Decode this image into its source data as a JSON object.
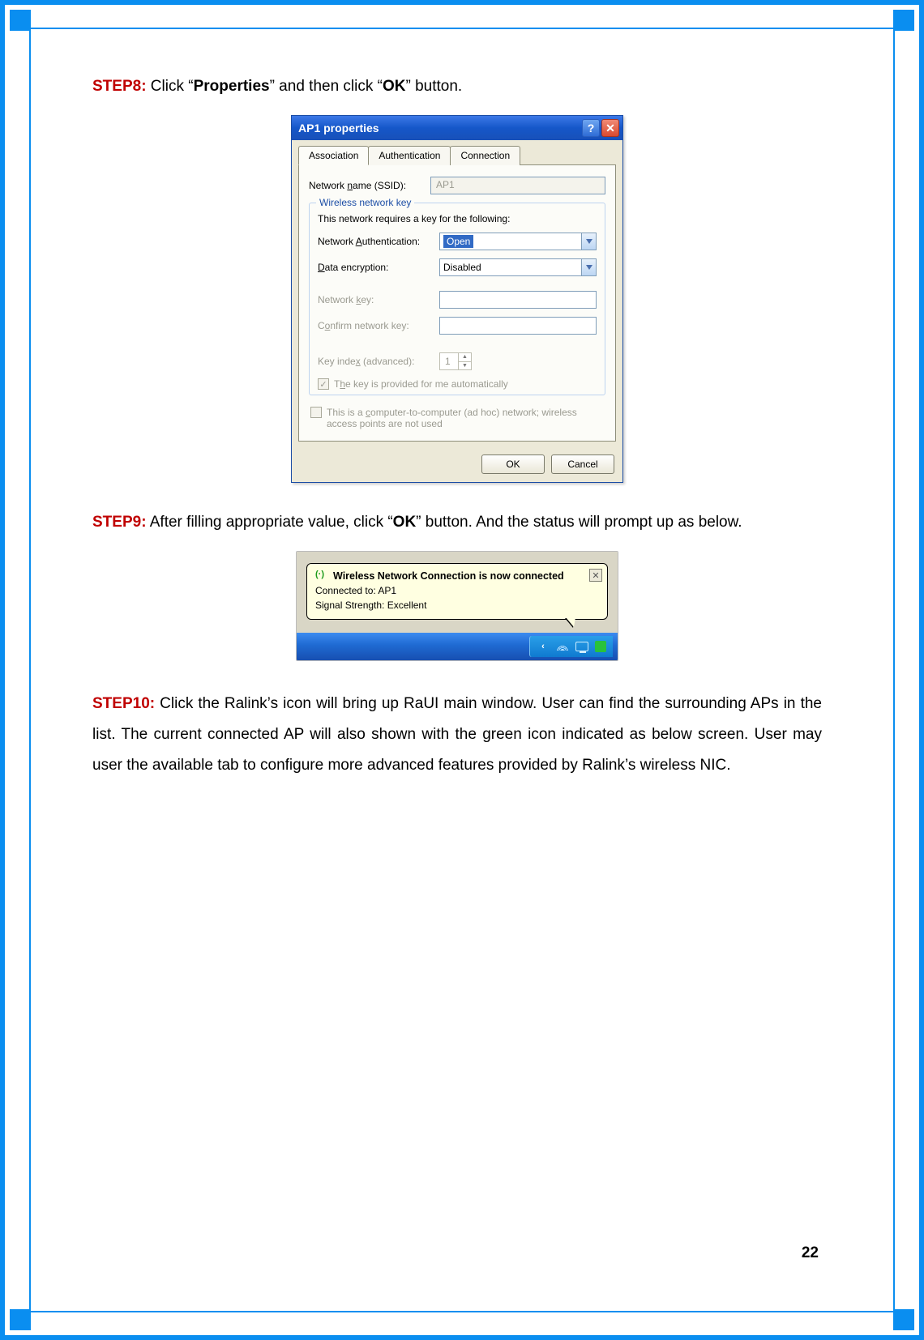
{
  "page_number": "22",
  "step8": {
    "label": "STEP8:",
    "text_before_properties": " Click “",
    "properties": "Properties",
    "text_mid": "” and then click “",
    "ok": "OK",
    "text_after_ok": "” button."
  },
  "dialog": {
    "title": "AP1 properties",
    "tabs": {
      "association": "Association",
      "authentication": "Authentication",
      "connection": "Connection"
    },
    "ssid_label_pre": "Network ",
    "ssid_label_u": "n",
    "ssid_label_post": "ame (SSID):",
    "ssid_value": "AP1",
    "group_legend": "Wireless network key",
    "group_desc": "This network requires a key for the following:",
    "auth_label_pre": "Network ",
    "auth_label_u": "A",
    "auth_label_post": "uthentication:",
    "auth_value": "Open",
    "enc_label_u": "D",
    "enc_label_post": "ata encryption:",
    "enc_value": "Disabled",
    "key_label_pre": "Network ",
    "key_label_u": "k",
    "key_label_post": "ey:",
    "confirm_label_pre": "C",
    "confirm_label_u": "o",
    "confirm_label_post": "nfirm network key:",
    "index_label_pre": "Key inde",
    "index_label_u": "x",
    "index_label_post": " (advanced):",
    "index_value": "1",
    "auto_key_pre": " T",
    "auto_key_u": "h",
    "auto_key_post": "e key is provided for me automatically",
    "adhoc_pre": "This is a ",
    "adhoc_u": "c",
    "adhoc_post": "omputer-to-computer (ad hoc) network; wireless access points are not used",
    "ok_btn": "OK",
    "cancel_btn": "Cancel"
  },
  "step9": {
    "label": "STEP9:",
    "text_before_ok": " After filling appropriate value, click “",
    "ok": "OK",
    "text_after_ok": "” button. And the status will prompt up as below."
  },
  "balloon": {
    "title": "Wireless Network Connection is now connected",
    "line1": "Connected to: AP1",
    "line2": "Signal Strength: Excellent"
  },
  "step10": {
    "label": "STEP10:",
    "text": " Click the Ralink’s icon will bring up RaUI main window. User can find the surrounding APs in the list. The current connected AP will also shown with the green icon indicated as below screen. User may user the available tab to configure more advanced features provided by Ralink’s wireless NIC."
  }
}
